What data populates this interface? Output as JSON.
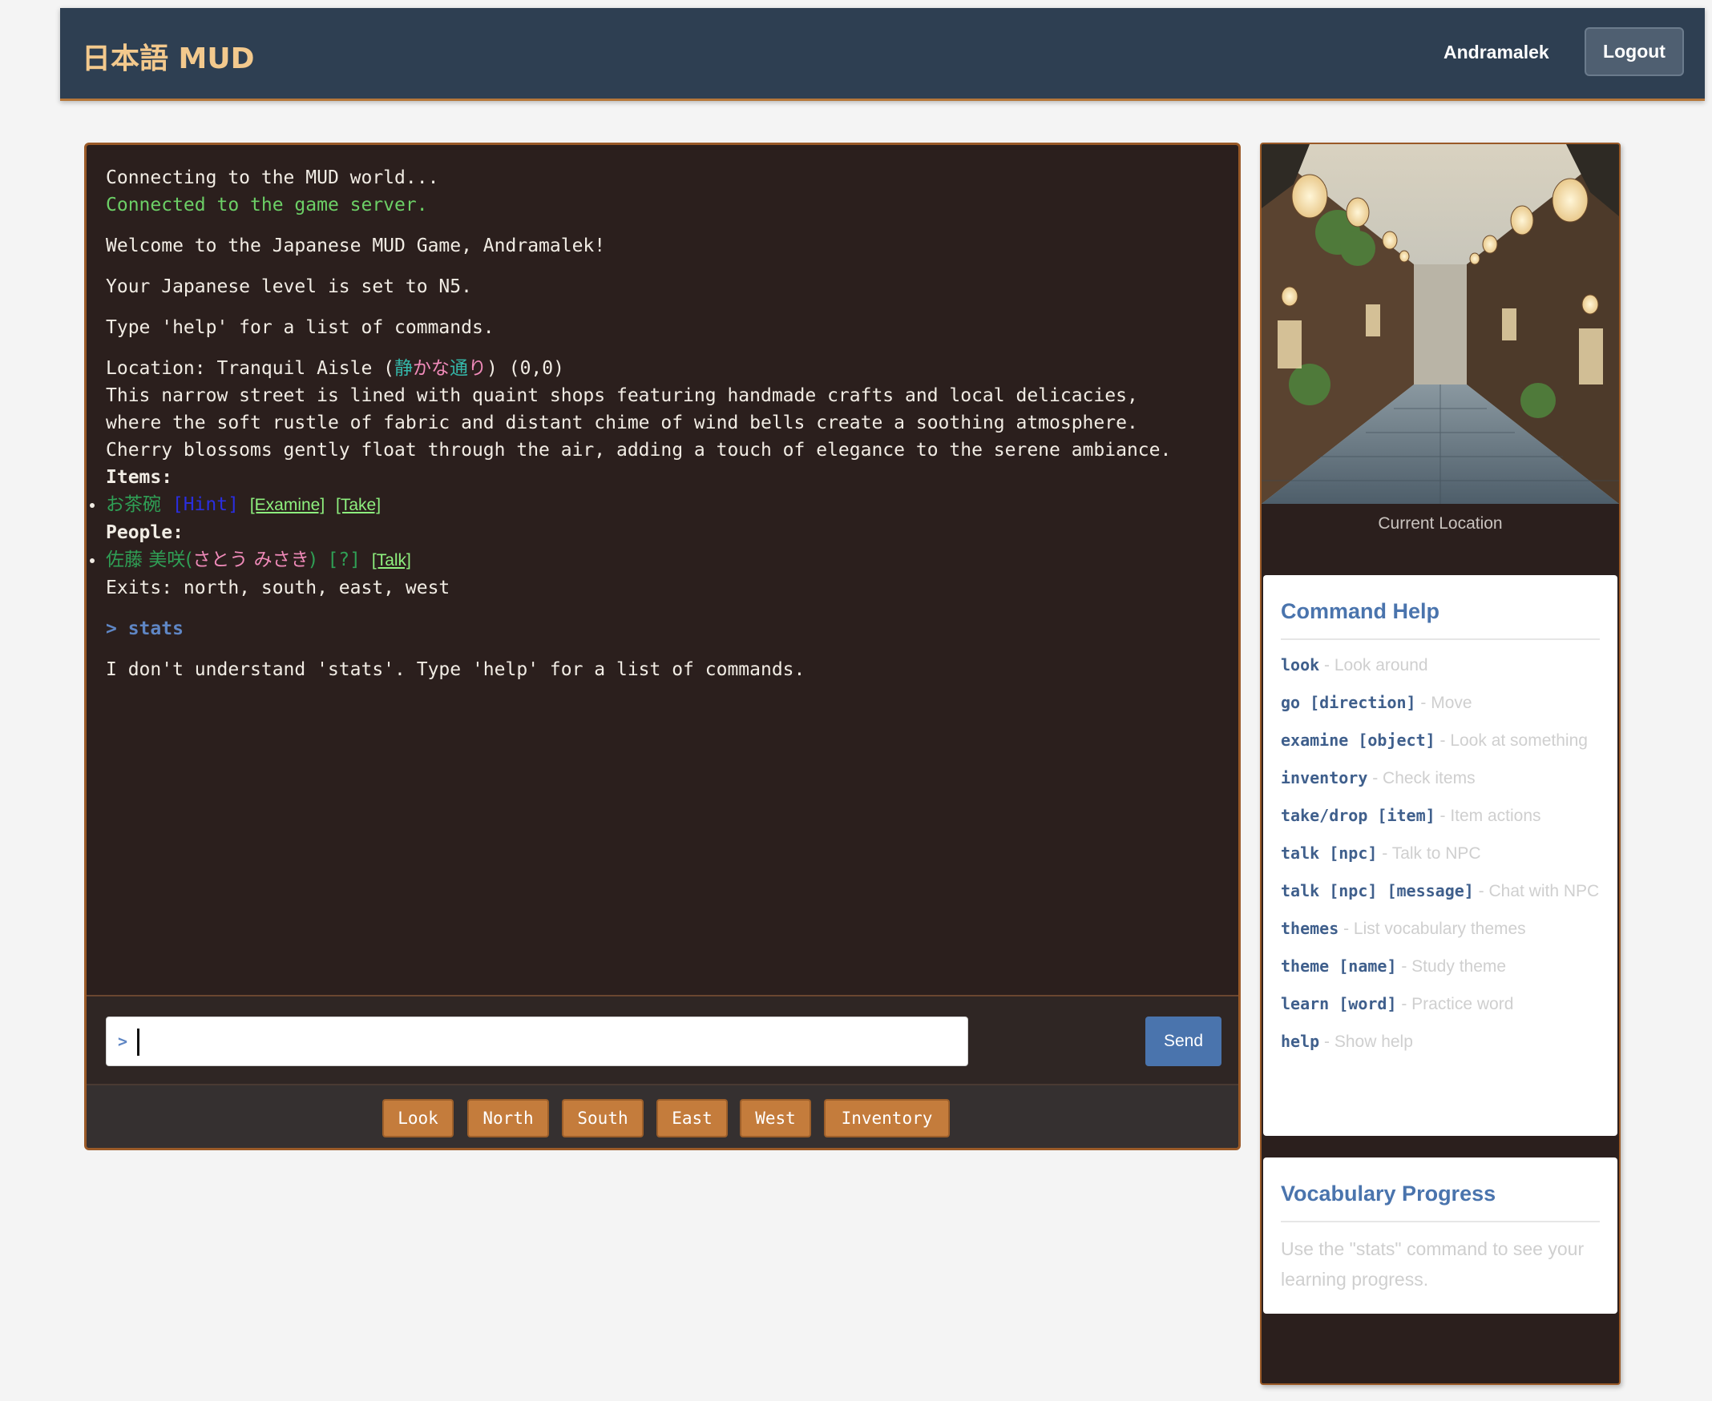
{
  "header": {
    "brand": "日本語 MUD",
    "username": "Andramalek",
    "logout_label": "Logout"
  },
  "output": {
    "connecting": "Connecting to the MUD world...",
    "connected": "Connected to the game server.",
    "welcome": "Welcome to the Japanese MUD Game, Andramalek!",
    "level": "Your Japanese level is set to N5.",
    "help_tip": "Type 'help' for a list of commands.",
    "location_prefix": "Location: Tranquil Aisle (",
    "location_jp_a": "静",
    "location_jp_b": "かな",
    "location_jp_c": "通",
    "location_jp_d": "り",
    "location_suffix": ") (0,0)",
    "desc1": "This narrow street is lined with quaint shops featuring handmade crafts and local delicacies,",
    "desc2": "where the soft rustle of fabric and distant chime of wind bells create a soothing atmosphere.",
    "desc3": "Cherry blossoms gently float through the air, adding a touch of elegance to the serene ambiance.",
    "items_label": "Items:",
    "item_name": "お茶碗",
    "item_hint": "[Hint]",
    "item_examine": "[Examine]",
    "item_take": "[Take]",
    "people_label": "People:",
    "npc_kanji": "佐藤 美咲",
    "npc_paren_open": "(",
    "npc_kana": "さとう みさき",
    "npc_paren_close": ")",
    "npc_q": "[?]",
    "npc_talk": "[Talk]",
    "exits": "Exits: north, south, east, west",
    "command_echo": "> stats",
    "response": "I don't understand 'stats'. Type 'help' for a list of commands."
  },
  "input": {
    "prompt": ">",
    "value": "",
    "send_label": "Send"
  },
  "quick_buttons": [
    "Look",
    "North",
    "South",
    "East",
    "West",
    "Inventory"
  ],
  "sidebar": {
    "caption": "Current Location",
    "help_title": "Command Help",
    "help_items": [
      {
        "cmd": "look",
        "desc": " - Look around"
      },
      {
        "cmd": "go [direction]",
        "desc": " - Move"
      },
      {
        "cmd": "examine [object]",
        "desc": " - Look at something"
      },
      {
        "cmd": "inventory",
        "desc": " - Check items"
      },
      {
        "cmd": "take/drop [item]",
        "desc": " - Item actions"
      },
      {
        "cmd": "talk [npc]",
        "desc": " - Talk to NPC"
      },
      {
        "cmd": "talk [npc] [message]",
        "desc": " - Chat with NPC"
      },
      {
        "cmd": "themes",
        "desc": " - List vocabulary themes"
      },
      {
        "cmd": "theme [name]",
        "desc": " - Study theme"
      },
      {
        "cmd": "learn [word]",
        "desc": " - Practice word"
      },
      {
        "cmd": "help",
        "desc": " - Show help"
      }
    ],
    "vocab_title": "Vocabulary Progress",
    "vocab_text": "Use the \"stats\" command to see your learning progress."
  }
}
